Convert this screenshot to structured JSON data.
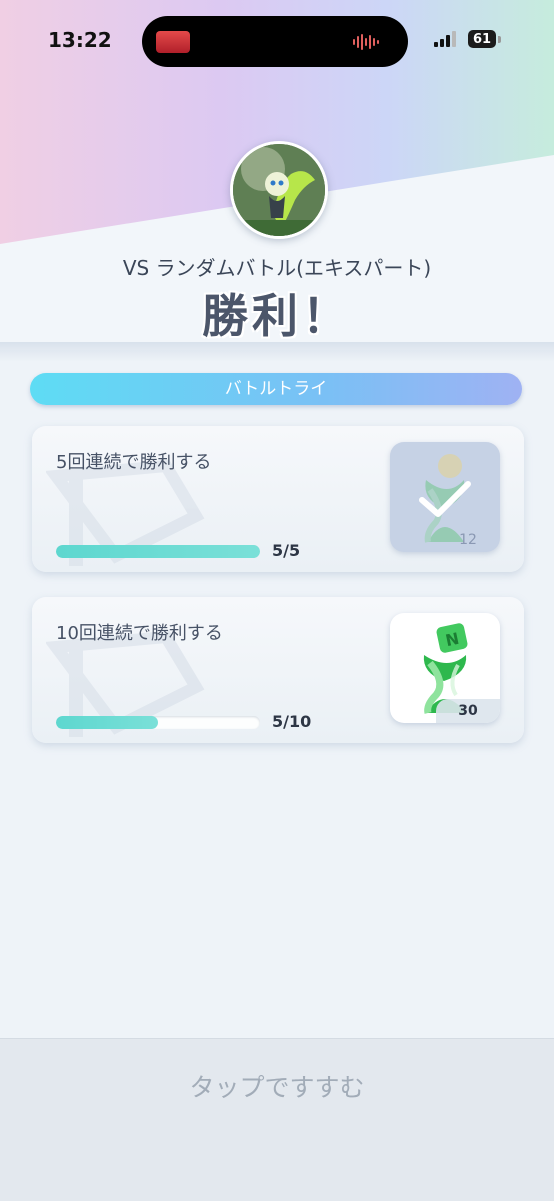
{
  "status_bar": {
    "time": "13:22",
    "battery": "61"
  },
  "result": {
    "mode": "VS ランダムバトル(エキスパート)",
    "outcome": "勝利！"
  },
  "section": {
    "title": "バトルトライ"
  },
  "missions": [
    {
      "title": "5回連続で勝利する",
      "progress_text": "5/5",
      "progress_fraction": 1.0,
      "reward_count": "12",
      "claimed": true
    },
    {
      "title": "10回連続で勝利する",
      "progress_text": "5/10",
      "progress_fraction": 0.5,
      "reward_count": "30",
      "claimed": false
    }
  ],
  "footer": {
    "continue_label": "タップですすむ"
  }
}
